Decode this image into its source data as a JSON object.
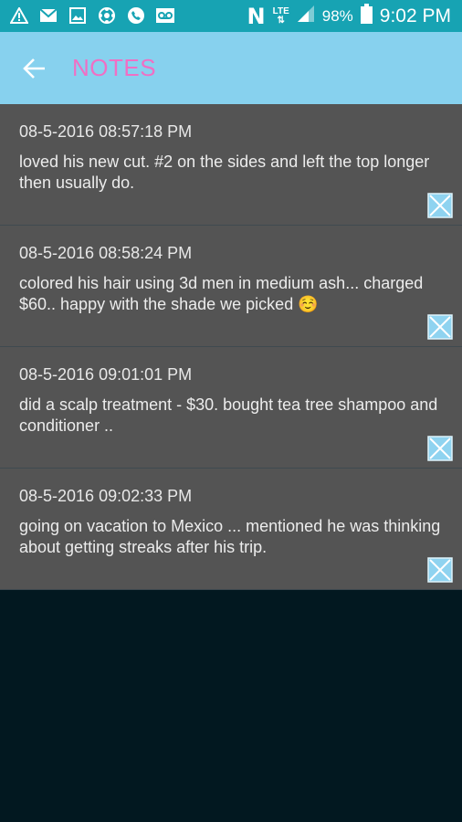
{
  "status_bar": {
    "battery": "98%",
    "time": "9:02 PM",
    "network": "LTE",
    "carrier_icon": "N",
    "icons_left": [
      "warning-icon",
      "mail-icon",
      "image-icon",
      "sync-icon",
      "phone-icon",
      "voicemail-icon"
    ]
  },
  "app_bar": {
    "title": "NOTES",
    "title_color": "#f06fc4",
    "background": "#87d1ee",
    "back_icon": "arrow-left-icon"
  },
  "notes": [
    {
      "timestamp": "08-5-2016 08:57:18 PM",
      "text": "loved his new cut. #2 on the sides and left the top longer then usually do."
    },
    {
      "timestamp": "08-5-2016 08:58:24 PM",
      "text": "colored his hair using 3d men in medium ash... charged $60.. happy with the shade we picked ☺️"
    },
    {
      "timestamp": "08-5-2016 09:01:01 PM",
      "text": "did a scalp treatment - $30. bought tea tree shampoo and conditioner .."
    },
    {
      "timestamp": "08-5-2016 09:02:33 PM",
      "text": "going on vacation to Mexico ... mentioned he was thinking about getting streaks after his trip."
    }
  ],
  "colors": {
    "status_bar": "#17a3b3",
    "note_background": "#545454",
    "page_background": "#021820",
    "delete_icon": "#8fd3f0"
  }
}
